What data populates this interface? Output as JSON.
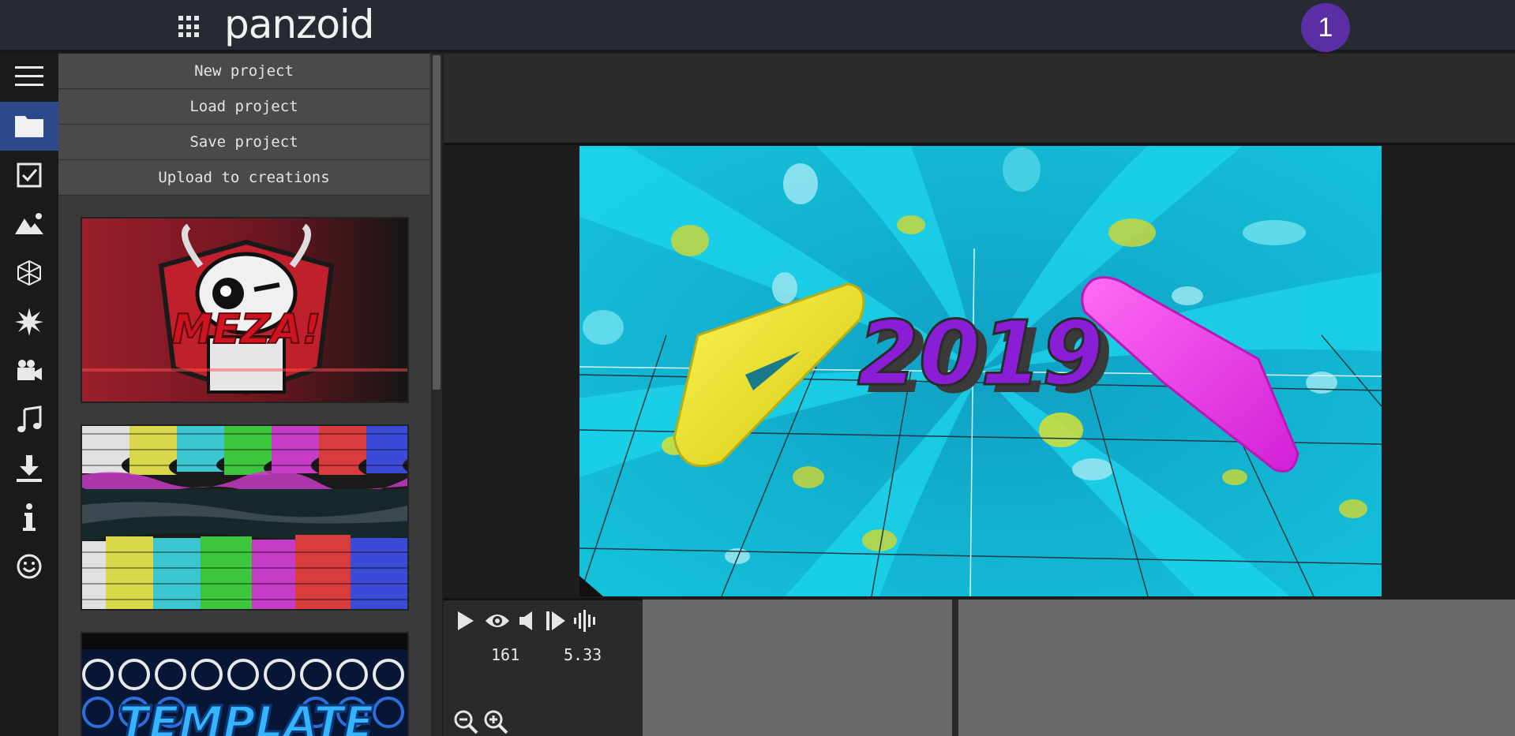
{
  "app": {
    "brand": "panzoid",
    "notification_count": "1"
  },
  "rail": {
    "items": [
      {
        "icon": "menu-icon"
      },
      {
        "icon": "folder-icon",
        "active": true
      },
      {
        "icon": "checkbox-icon"
      },
      {
        "icon": "landscape-icon"
      },
      {
        "icon": "cube-icon"
      },
      {
        "icon": "starburst-icon"
      },
      {
        "icon": "camera-icon"
      },
      {
        "icon": "music-note-icon"
      },
      {
        "icon": "download-icon"
      },
      {
        "icon": "info-icon"
      },
      {
        "icon": "smiley-icon"
      }
    ]
  },
  "project_menu": {
    "new_project": "New project",
    "load_project": "Load project",
    "save_project": "Save project",
    "upload": "Upload to creations"
  },
  "templates": {
    "thumb1_text": "MEZA!",
    "thumb3_text": "TEMPLATE"
  },
  "preview": {
    "text": "2019"
  },
  "playback": {
    "frame": "161",
    "time": "5.33"
  },
  "colors": {
    "accent": "#2c4a8a",
    "notification": "#5b2ea6",
    "preview_bg": "#17b6d0",
    "shape_left": "#f2ea2a",
    "shape_right": "#ee3ae8",
    "title_purple": "#8a1ed6"
  }
}
